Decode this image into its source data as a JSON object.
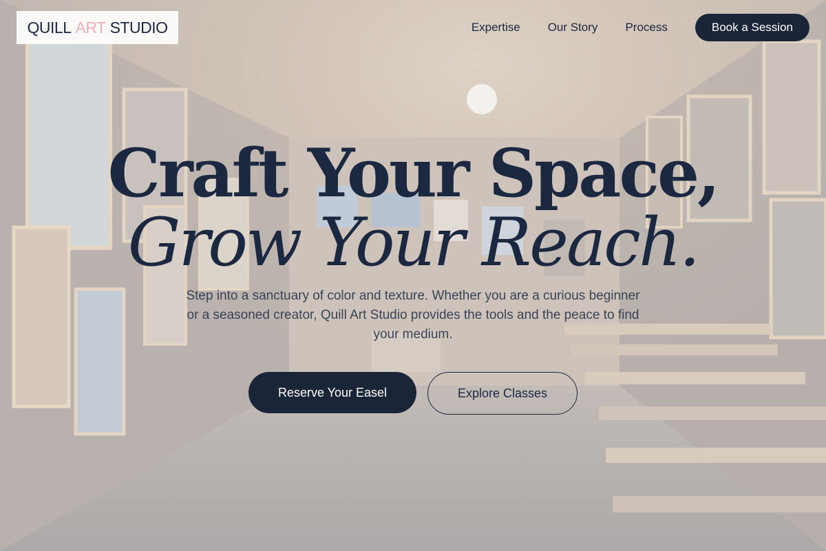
{
  "brand": {
    "name_left": "QUILL",
    "name_accent": "ART",
    "name_right": "STUDIO"
  },
  "nav": {
    "links": [
      "Expertise",
      "Our Story",
      "Process"
    ],
    "cta_label": "Book a Session"
  },
  "hero": {
    "headline_line1": "Craft Your Space,",
    "headline_line2": "Grow Your Reach.",
    "subtext": "Step into a sanctuary of color and texture. Whether you are a curious beginner or a seasoned creator, Quill Art Studio provides the tools and the peace to find your medium.",
    "primary_cta": "Reserve Your Easel",
    "secondary_cta": "Explore Classes"
  },
  "colors": {
    "ink": "#1c2740",
    "button_dark": "#1b2538",
    "accent_pink": "#f0aeb9"
  }
}
